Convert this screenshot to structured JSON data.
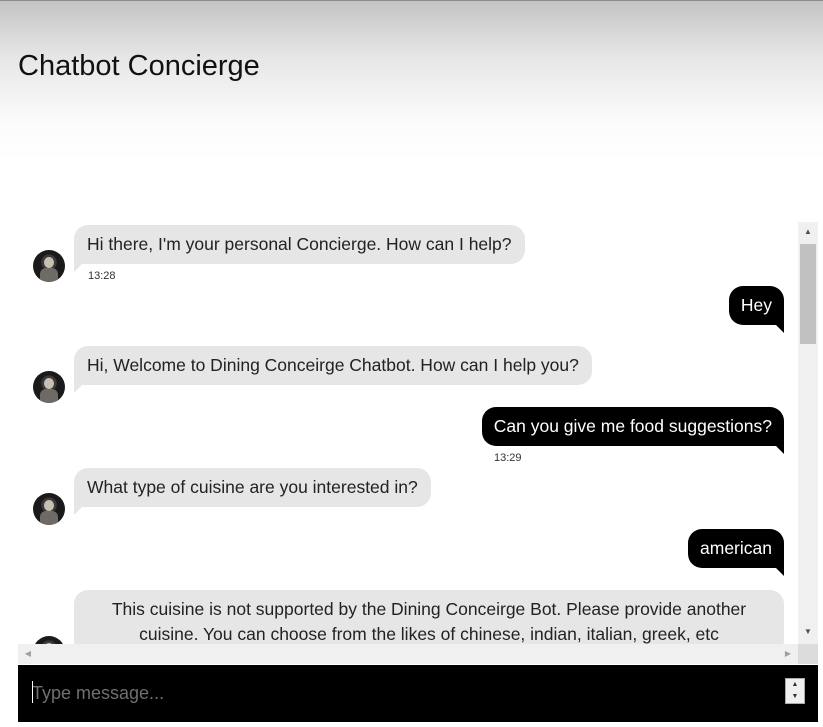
{
  "app": {
    "title": "Chatbot Concierge"
  },
  "messages": [
    {
      "sender": "bot",
      "text": "Hi there, I'm your personal Concierge. How can I help?",
      "time": "13:28"
    },
    {
      "sender": "user",
      "text": "Hey"
    },
    {
      "sender": "bot",
      "text": "Hi, Welcome to Dining Conceirge Chatbot. How can I help you?"
    },
    {
      "sender": "user",
      "text": "Can you give me food suggestions?",
      "time": "13:29"
    },
    {
      "sender": "bot",
      "text": "What type of cuisine are you interested in?"
    },
    {
      "sender": "user",
      "text": "american"
    },
    {
      "sender": "bot",
      "text": "This cuisine is not supported by the Dining Conceirge Bot. Please provide another cuisine. You can choose from the likes of chinese, indian, italian, greek, etc"
    }
  ],
  "composer": {
    "placeholder": "Type message..."
  },
  "icons": {
    "bot_avatar": "bot-avatar-photo",
    "scroll_up": "triangle-up-icon",
    "scroll_down": "triangle-down-icon",
    "scroll_left": "triangle-left-icon",
    "scroll_right": "triangle-right-icon"
  },
  "colors": {
    "bot_bubble": "#e6e6e6",
    "user_bubble": "#000000",
    "input_bar": "#000000"
  }
}
